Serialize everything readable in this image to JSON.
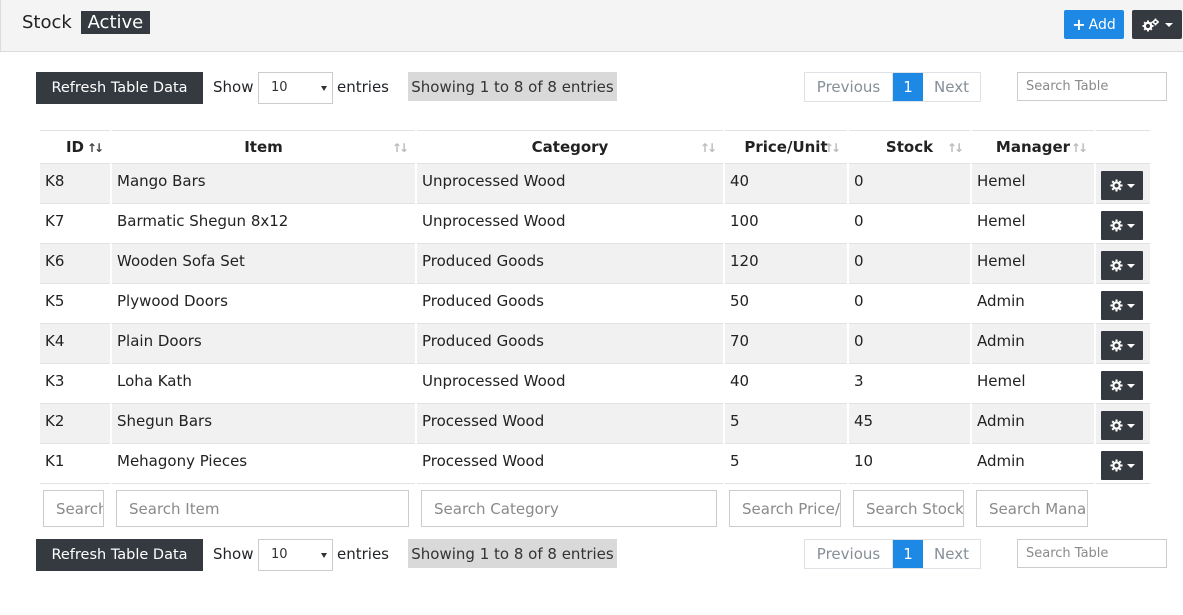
{
  "header": {
    "title": "Stock",
    "badge": "Active",
    "add_label": "Add"
  },
  "controls": {
    "refresh_label": "Refresh Table Data",
    "show_label": "Show",
    "page_size": "10",
    "entries_label": "entries",
    "info": "Showing 1 to 8 of 8 entries",
    "prev_label": "Previous",
    "current_page": "1",
    "next_label": "Next",
    "search_placeholder": "Search Table"
  },
  "table": {
    "columns": [
      "ID",
      "Item",
      "Category",
      "Price/Unit",
      "Stock",
      "Manager"
    ],
    "rows": [
      [
        "K8",
        "Mango Bars",
        "Unprocessed Wood",
        "40",
        "0",
        "Hemel"
      ],
      [
        "K7",
        "Barmatic Shegun 8x12",
        "Unprocessed Wood",
        "100",
        "0",
        "Hemel"
      ],
      [
        "K6",
        "Wooden Sofa Set",
        "Produced Goods",
        "120",
        "0",
        "Hemel"
      ],
      [
        "K5",
        "Plywood Doors",
        "Produced Goods",
        "50",
        "0",
        "Admin"
      ],
      [
        "K4",
        "Plain Doors",
        "Produced Goods",
        "70",
        "0",
        "Admin"
      ],
      [
        "K3",
        "Loha Kath",
        "Unprocessed Wood",
        "40",
        "3",
        "Hemel"
      ],
      [
        "K2",
        "Shegun Bars",
        "Processed Wood",
        "5",
        "45",
        "Admin"
      ],
      [
        "K1",
        "Mehagony Pieces",
        "Processed Wood",
        "5",
        "10",
        "Admin"
      ]
    ]
  },
  "filters": {
    "id": "Search ID",
    "item": "Search Item",
    "category": "Search Category",
    "price": "Search Price/Unit",
    "stock": "Search Stock",
    "manager": "Search Manager"
  },
  "colors": {
    "primary": "#1e88e5",
    "dark": "#343a40",
    "stripe": "#f1f1f1"
  }
}
